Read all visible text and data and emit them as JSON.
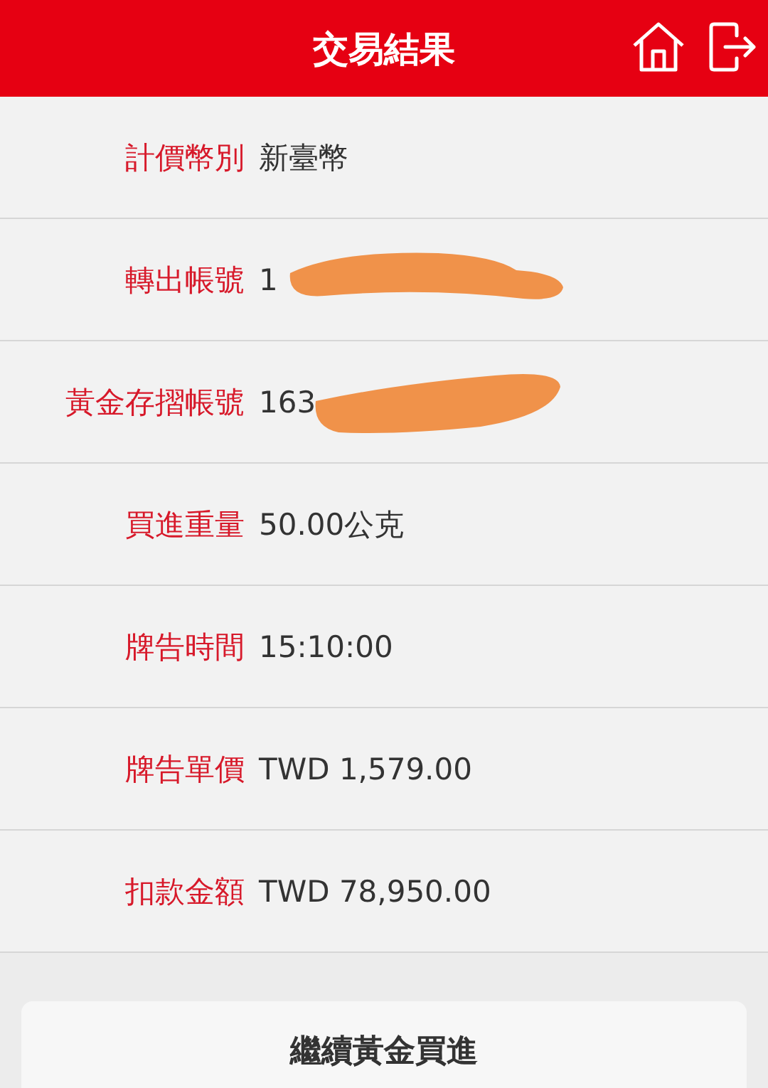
{
  "header": {
    "title": "交易結果"
  },
  "rows": [
    {
      "label": "計價幣別",
      "value": "新臺幣",
      "redacted": false
    },
    {
      "label": "轉出帳號",
      "value": "1",
      "redacted": true
    },
    {
      "label": "黃金存摺帳號",
      "value": "163",
      "redacted": true
    },
    {
      "label": "買進重量",
      "value": "50.00公克",
      "redacted": false
    },
    {
      "label": "牌告時間",
      "value": "15:10:00",
      "redacted": false
    },
    {
      "label": "牌告單價",
      "value": "TWD 1,579.00",
      "redacted": false
    },
    {
      "label": "扣款金額",
      "value": "TWD 78,950.00",
      "redacted": false
    }
  ],
  "button": {
    "label": "繼續黃金買進"
  }
}
